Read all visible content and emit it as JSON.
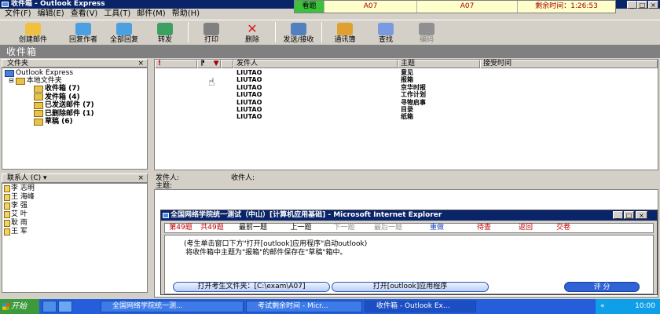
{
  "window": {
    "title": "收件箱 - Outlook Express",
    "min": "_",
    "max": "□",
    "close": "×"
  },
  "exam_bar": {
    "status": "看题",
    "code1": "A07",
    "code2": "A07",
    "time_label": "剩余时间：1:26:53"
  },
  "menu": [
    "文件(F)",
    "编辑(E)",
    "查看(V)",
    "工具(T)",
    "邮件(M)",
    "帮助(H)"
  ],
  "toolbar": [
    {
      "label": "创建邮件",
      "icon": "new-mail-icon"
    },
    {
      "label": "回复作者",
      "icon": "reply-icon"
    },
    {
      "label": "全部回复",
      "icon": "reply-all-icon"
    },
    {
      "label": "转发",
      "icon": "forward-icon"
    },
    {
      "label": "打印",
      "icon": "print-icon"
    },
    {
      "label": "删除",
      "icon": "delete-icon"
    },
    {
      "label": "发送/接收",
      "icon": "send-receive-icon"
    },
    {
      "label": "通讯簿",
      "icon": "address-book-icon"
    },
    {
      "label": "查找",
      "icon": "find-icon"
    },
    {
      "label": "编码",
      "icon": "encoding-icon"
    }
  ],
  "path_bar": "收件箱",
  "folders_header": "文件夹",
  "folders_close": "×",
  "folders": {
    "root": "Outlook Express",
    "local": "本地文件夹",
    "items": [
      "收件箱 (7)",
      "发件箱 (4)",
      "已发送邮件 (7)",
      "已删除邮件 (1)",
      "草稿 (6)"
    ]
  },
  "contacts_header": "联系人 (C) ▾",
  "contacts_close": "×",
  "contacts": [
    "李 志明",
    "王 海峰",
    "李 强",
    "艾 叶",
    "耿 雨",
    "王 军"
  ],
  "message_columns": {
    "flag": "!",
    "attach": "⁋",
    "from": "发件人",
    "subject": "主题",
    "received": "接受时间"
  },
  "messages": [
    {
      "from": "LIUTAO",
      "subject": "意见"
    },
    {
      "from": "LIUTAO",
      "subject": "报箱"
    },
    {
      "from": "LIUTAO",
      "subject": "京华时报"
    },
    {
      "from": "LIUTAO",
      "subject": "工作计划"
    },
    {
      "from": "LIUTAO",
      "subject": "寻物启事"
    },
    {
      "from": "LIUTAO",
      "subject": "目录"
    },
    {
      "from": "LIUTAO",
      "subject": "纸箱"
    }
  ],
  "preview": {
    "from_label": "发件人:",
    "to_label": "收件人:",
    "subject_label": "主题:"
  },
  "ie": {
    "title": "全国网络学院统一测试（中山）[计算机应用基础] - Microsoft Internet Explorer",
    "q_current": "第49题",
    "q_total": "共49题",
    "nav": [
      "最前一题",
      "上一题",
      "下一题",
      "最后一题"
    ],
    "redo": "重做",
    "review": "待查",
    "back": "返回",
    "submit": "交卷",
    "instruction1": "(考生单击窗口下方\"打开[outlook]应用程序\"启动outlook)",
    "instruction2": "将收件箱中主题为\"报箱\"的邮件保存在\"草稿\"箱中。",
    "btn_open_folder": "打开考生文件夹：[C:\\exam\\A07]",
    "btn_open_app": "打开[outlook]应用程序",
    "btn_score": "评 分"
  },
  "taskbar": {
    "start": "开始",
    "items": [
      "全国网络学院统一测...",
      "考试剩余时间 - Micr...",
      "收件箱 - Outlook Ex..."
    ],
    "tray_left": "«",
    "clock": "10:00"
  }
}
